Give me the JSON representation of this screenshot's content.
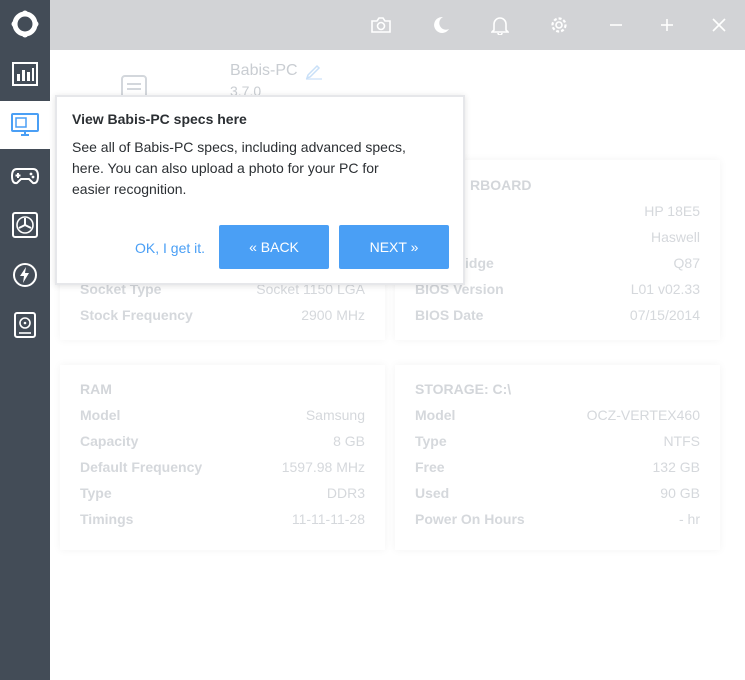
{
  "app": {
    "title": "Babis-PC"
  },
  "sidebar": {
    "items": [
      {
        "icon": "logo-icon"
      },
      {
        "icon": "dashboard-icon"
      },
      {
        "icon": "pc-specs-icon",
        "active": true
      },
      {
        "icon": "gamepad-icon"
      },
      {
        "icon": "fan-icon"
      },
      {
        "icon": "lightning-icon"
      },
      {
        "icon": "disk-icon"
      }
    ]
  },
  "topbar": {
    "icons": [
      "camera-icon",
      "moon-icon",
      "bell-icon",
      "gear-icon",
      "minimize-icon",
      "maximize-icon",
      "close-icon"
    ]
  },
  "pc": {
    "name": "Babis-PC",
    "version": "3.7.0"
  },
  "cpu_partial": {
    "rows": [
      {
        "k": "Socket Type",
        "v": "Socket 1150 LGA"
      },
      {
        "k": "Stock Frequency",
        "v": "2900 MHz"
      }
    ]
  },
  "motherboard": {
    "title": "MOTHERBOARD",
    "title_visible": "RBOARD",
    "rows": [
      {
        "k": "",
        "v": "HP 18E5"
      },
      {
        "k": "",
        "v": "Haswell"
      },
      {
        "k": "idge",
        "v": "Q87"
      },
      {
        "k": "BIOS Version",
        "v": "L01 v02.33"
      },
      {
        "k": "BIOS Date",
        "v": "07/15/2014"
      }
    ]
  },
  "ram": {
    "title": "RAM",
    "rows": [
      {
        "k": "Model",
        "v": "Samsung"
      },
      {
        "k": "Capacity",
        "v": "8 GB"
      },
      {
        "k": "Default Frequency",
        "v": "1597.98 MHz"
      },
      {
        "k": "Type",
        "v": "DDR3"
      },
      {
        "k": "Timings",
        "v": "11-11-11-28"
      }
    ]
  },
  "storage": {
    "title": "STORAGE: C:\\",
    "rows": [
      {
        "k": "Model",
        "v": "OCZ-VERTEX460"
      },
      {
        "k": "Type",
        "v": "NTFS"
      },
      {
        "k": "Free",
        "v": "132 GB"
      },
      {
        "k": "Used",
        "v": "90 GB"
      },
      {
        "k": "Power On Hours",
        "v": "- hr"
      }
    ]
  },
  "tooltip": {
    "title": "View Babis-PC specs here",
    "body": "See all of Babis-PC specs, including advanced specs, here. You can also upload a photo for your PC for easier recognition.",
    "ok_label": "OK, I get it.",
    "back_label": "« BACK",
    "next_label": "NEXT »"
  },
  "colors": {
    "sidebar_bg": "#434c57",
    "topbar_bg": "#d2d3d6",
    "accent": "#4a9ff5"
  }
}
